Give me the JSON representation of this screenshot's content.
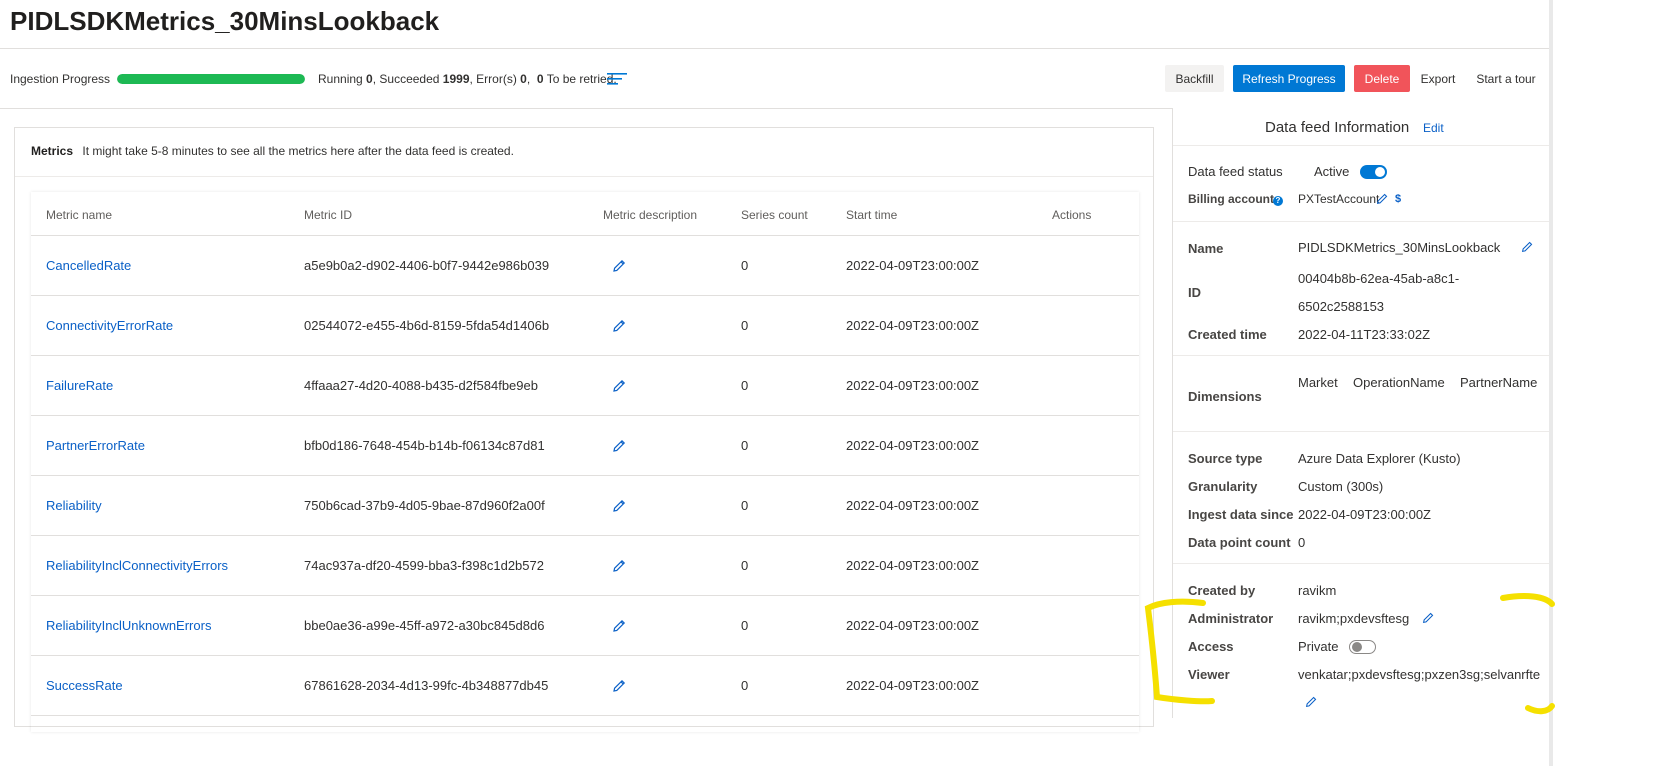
{
  "page": {
    "title": "PIDLSDKMetrics_30MinsLookback"
  },
  "ingestion": {
    "label": "Ingestion Progress",
    "progress_fraction": 1.0,
    "running_label": "Running",
    "running_value": "0",
    "succeeded_label": ", Succeeded",
    "succeeded_value": "1999",
    "errors_label": ", Error(s)",
    "errors_value": "0",
    "retry_sep": ",",
    "retry_value": "0",
    "retry_label": "To be retried."
  },
  "actions": {
    "backfill": "Backfill",
    "refresh": "Refresh Progress",
    "delete": "Delete",
    "export": "Export",
    "tour": "Start a tour"
  },
  "metrics": {
    "title": "Metrics",
    "note": "It might take 5-8 minutes to see all the metrics here after the data feed is created.",
    "columns": [
      "Metric name",
      "Metric ID",
      "Metric description",
      "Series count",
      "Start time",
      "Actions"
    ],
    "rows": [
      {
        "name": "CancelledRate",
        "id": "a5e9b0a2-d902-4406-b0f7-9442e986b039",
        "count": "0",
        "start": "2022-04-09T23:00:00Z"
      },
      {
        "name": "ConnectivityErrorRate",
        "id": "02544072-e455-4b6d-8159-5fda54d1406b",
        "count": "0",
        "start": "2022-04-09T23:00:00Z"
      },
      {
        "name": "FailureRate",
        "id": "4ffaaa27-4d20-4088-b435-d2f584fbe9eb",
        "count": "0",
        "start": "2022-04-09T23:00:00Z"
      },
      {
        "name": "PartnerErrorRate",
        "id": "bfb0d186-7648-454b-b14b-f06134c87d81",
        "count": "0",
        "start": "2022-04-09T23:00:00Z"
      },
      {
        "name": "Reliability",
        "id": "750b6cad-37b9-4d05-9bae-87d960f2a00f",
        "count": "0",
        "start": "2022-04-09T23:00:00Z"
      },
      {
        "name": "ReliabilityInclConnectivityErrors",
        "id": "74ac937a-df20-4599-bba3-f398c1d2b572",
        "count": "0",
        "start": "2022-04-09T23:00:00Z"
      },
      {
        "name": "ReliabilityInclUnknownErrors",
        "id": "bbe0ae36-a99e-45ff-a972-a30bc845d8d6",
        "count": "0",
        "start": "2022-04-09T23:00:00Z"
      },
      {
        "name": "SuccessRate",
        "id": "67861628-2034-4d13-99fc-4b348877db45",
        "count": "0",
        "start": "2022-04-09T23:00:00Z"
      }
    ]
  },
  "info": {
    "title": "Data feed Information",
    "edit": "Edit",
    "status_label": "Data feed status",
    "status_value": "Active",
    "status_on": true,
    "billing_label": "Billing account",
    "billing_value": "PXTestAccount",
    "billing_icon": "$",
    "name_label": "Name",
    "name_value": "PIDLSDKMetrics_30MinsLookback",
    "id_label": "ID",
    "id_line1": "00404b8b-62ea-45ab-a8c1-",
    "id_line2": "6502c2588153",
    "created_label": "Created time",
    "created_value": "2022-04-11T23:33:02Z",
    "dimensions_label": "Dimensions",
    "dimensions": [
      "Market",
      "OperationName",
      "PartnerName"
    ],
    "source_label": "Source type",
    "source_value": "Azure Data Explorer (Kusto)",
    "granularity_label": "Granularity",
    "granularity_value": "Custom (300s)",
    "ingest_label": "Ingest data since",
    "ingest_value": "2022-04-09T23:00:00Z",
    "datapoint_label": "Data point count",
    "datapoint_value": "0",
    "createdby_label": "Created by",
    "createdby_value": "ravikm",
    "admin_label": "Administrator",
    "admin_value": "ravikm;pxdevsftesg",
    "access_label": "Access",
    "access_value": "Private",
    "access_on": false,
    "viewer_label": "Viewer",
    "viewer_value": "venkatar;pxdevsftesg;pxzen3sg;selvanrfte"
  },
  "colors": {
    "accent": "#0078d4",
    "link": "#0a60c7",
    "progress": "#1db954",
    "delete": "#f1545a",
    "annotation": "#f5e000"
  }
}
